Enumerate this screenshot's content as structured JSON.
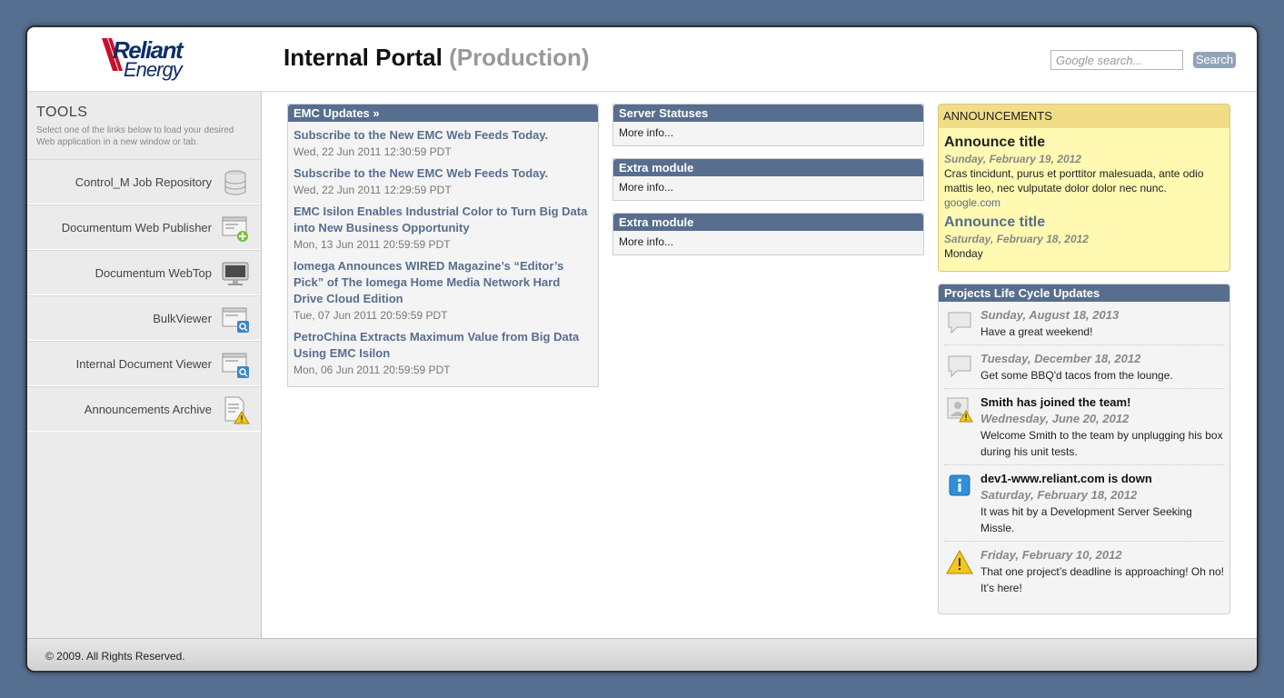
{
  "header": {
    "logo_line1": "Reliant",
    "logo_line2": "Energy",
    "title": "Internal Portal",
    "environment": "(Production)",
    "search_placeholder": "Google search...",
    "search_button": "Search"
  },
  "sidebar": {
    "title": "TOOLS",
    "description": "Select one of the links below to load your desired Web application in a new window or tab.",
    "items": [
      {
        "label": "Control_M Job Repository",
        "icon": "database-icon"
      },
      {
        "label": "Documentum Web Publisher",
        "icon": "web-add-icon"
      },
      {
        "label": "Documentum WebTop",
        "icon": "monitor-icon"
      },
      {
        "label": "BulkViewer",
        "icon": "window-search-icon"
      },
      {
        "label": "Internal Document Viewer",
        "icon": "window-search-icon"
      },
      {
        "label": "Announcements Archive",
        "icon": "document-warning-icon"
      }
    ]
  },
  "emc": {
    "title": "EMC Updates »",
    "items": [
      {
        "title": "Subscribe to the New EMC Web Feeds Today.",
        "date": "Wed, 22 Jun 2011 12:30:59 PDT"
      },
      {
        "title": "Subscribe to the New EMC Web Feeds Today.",
        "date": "Wed, 22 Jun 2011 12:29:59 PDT"
      },
      {
        "title": "EMC Isilon Enables Industrial Color to Turn Big Data into New Business Opportunity",
        "date": "Mon, 13 Jun 2011 20:59:59 PDT"
      },
      {
        "title": "Iomega Announces WIRED Magazine’s “Editor’s Pick” of The Iomega Home Media Network Hard Drive Cloud Edition",
        "date": "Tue, 07 Jun 2011 20:59:59 PDT"
      },
      {
        "title": "PetroChina Extracts Maximum Value from Big Data Using EMC Isilon",
        "date": "Mon, 06 Jun 2011 20:59:59 PDT"
      }
    ]
  },
  "modules": [
    {
      "title": "Server Statuses",
      "link": "More info..."
    },
    {
      "title": "Extra module",
      "link": "More info..."
    },
    {
      "title": "Extra module",
      "link": "More info..."
    }
  ],
  "announcements": {
    "title": "ANNOUNCEMENTS",
    "items": [
      {
        "title": "Announce title",
        "date": "Sunday, February 19, 2012",
        "body": "Cras tincidunt, purus et porttitor malesuada, ante odio mattis leo, nec vulputate dolor dolor nec nunc.",
        "link": "google.com"
      },
      {
        "title": "Announce title",
        "date": "Saturday, February 18, 2012",
        "body": "Monday"
      }
    ]
  },
  "plc": {
    "title": "Projects Life Cycle Updates",
    "items": [
      {
        "icon": "speech-bubble-icon",
        "title": "",
        "date": "Sunday, August 18, 2013",
        "body": "Have a great weekend!"
      },
      {
        "icon": "speech-bubble-icon",
        "title": "",
        "date": "Tuesday, December 18, 2012",
        "body": "Get some BBQ'd tacos from the lounge."
      },
      {
        "icon": "user-warning-icon",
        "title": "Smith has joined the team!",
        "date": "Wednesday, June 20, 2012",
        "body": "Welcome Smith to the team by unplugging his box during his unit tests."
      },
      {
        "icon": "info-icon",
        "title": "dev1-www.reliant.com is down",
        "date": "Saturday, February 18, 2012",
        "body": "It was hit by a Development Server Seeking Missle."
      },
      {
        "icon": "warning-icon",
        "title": "",
        "date": "Friday, February 10, 2012",
        "body": "That one project’s deadline is approaching! Oh no! It’s here!"
      }
    ]
  },
  "footer": {
    "text": "© 2009. All Rights Reserved."
  },
  "colors": {
    "background": "#566f90",
    "module_header": "#576e8e",
    "announce_bg": "#fff9b1",
    "announce_header": "#f1dc88"
  }
}
